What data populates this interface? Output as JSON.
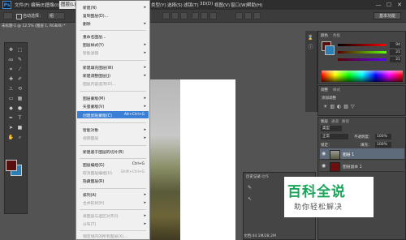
{
  "menubar": {
    "logo": "Ps",
    "items": [
      "文件(F)",
      "编辑(E)",
      "图像(I)",
      "图层(L)",
      "类型(Y)",
      "选择(S)",
      "滤镜(T)",
      "3D(D)",
      "视图(V)",
      "窗口(W)",
      "帮助(H)"
    ],
    "window_controls": [
      "—",
      "☐",
      "✕"
    ]
  },
  "options_bar": {
    "auto_select_label": "自动选择：",
    "auto_select_value": "组",
    "workspace_button": "基本功能"
  },
  "document_tab": {
    "title": "未标题-1 @ 12.5% (图层 1, RGB/8) *"
  },
  "layer_menu": {
    "items": [
      {
        "label": "新建(N)",
        "shortcut": "",
        "submenu": true,
        "disabled": false
      },
      {
        "label": "复制图层(D)...",
        "shortcut": "",
        "submenu": false,
        "disabled": false
      },
      {
        "label": "删除",
        "shortcut": "",
        "submenu": true,
        "disabled": false
      },
      {
        "label": "重命名图层...",
        "shortcut": "",
        "submenu": false,
        "disabled": false
      },
      {
        "label": "图层样式(Y)",
        "shortcut": "",
        "submenu": true,
        "disabled": false
      },
      {
        "label": "智能滤镜",
        "shortcut": "",
        "submenu": true,
        "disabled": true
      },
      {
        "label": "新建填充图层(W)",
        "shortcut": "",
        "submenu": true,
        "disabled": false
      },
      {
        "label": "新建调整图层(J)",
        "shortcut": "",
        "submenu": true,
        "disabled": false
      },
      {
        "label": "图层内容选项(O)...",
        "shortcut": "",
        "submenu": false,
        "disabled": true
      },
      {
        "label": "图层蒙版(M)",
        "shortcut": "",
        "submenu": true,
        "disabled": false
      },
      {
        "label": "矢量蒙版(V)",
        "shortcut": "",
        "submenu": true,
        "disabled": false
      },
      {
        "label": "创建剪贴蒙版(C)",
        "shortcut": "Alt+Ctrl+G",
        "submenu": false,
        "disabled": false,
        "highlighted": true
      },
      {
        "label": "智能对象",
        "shortcut": "",
        "submenu": true,
        "disabled": false
      },
      {
        "label": "视频图层",
        "shortcut": "",
        "submenu": true,
        "disabled": true
      },
      {
        "label": "新建基于图层的切片(B)",
        "shortcut": "",
        "submenu": false,
        "disabled": false
      },
      {
        "label": "图层编组(G)",
        "shortcut": "Ctrl+G",
        "submenu": false,
        "disabled": false
      },
      {
        "label": "取消图层编组(U)",
        "shortcut": "Shift+Ctrl+G",
        "submenu": false,
        "disabled": true
      },
      {
        "label": "隐藏图层(R)",
        "shortcut": "",
        "submenu": false,
        "disabled": false
      },
      {
        "label": "排列(A)",
        "shortcut": "",
        "submenu": true,
        "disabled": false
      },
      {
        "label": "合并形状(H)",
        "shortcut": "",
        "submenu": true,
        "disabled": true
      },
      {
        "label": "将图层与选区对齐(I)",
        "shortcut": "",
        "submenu": true,
        "disabled": true
      },
      {
        "label": "分布(T)",
        "shortcut": "",
        "submenu": true,
        "disabled": true
      },
      {
        "label": "锁定组内的所有图层(X)...",
        "shortcut": "",
        "submenu": false,
        "disabled": true
      }
    ]
  },
  "color_panel": {
    "tabs": [
      "颜色",
      "色板"
    ],
    "values": [
      "94",
      "21",
      "21"
    ]
  },
  "adjust_panel": {
    "tabs": [
      "调整",
      "样式"
    ],
    "title": "添加调整"
  },
  "layers_panel": {
    "tabs": [
      "图层",
      "通道",
      "路径"
    ],
    "filter": "类型",
    "blend_mode": "正常",
    "opacity_label": "不透明度：",
    "opacity_value": "100%",
    "lock_label": "锁定：",
    "fill_label": "填充：",
    "fill_value": "100%",
    "layers": [
      {
        "name": "图层 1",
        "selected": true
      },
      {
        "name": "图层副本 1",
        "selected": false
      }
    ]
  },
  "history_panel": {
    "tabs": [
      "历史记录",
      "动作"
    ]
  },
  "status_bar": {
    "text": "文档:44.1M/28.2M"
  },
  "watermark": {
    "logo": "百科全说",
    "sub": "助你轻松解决"
  }
}
